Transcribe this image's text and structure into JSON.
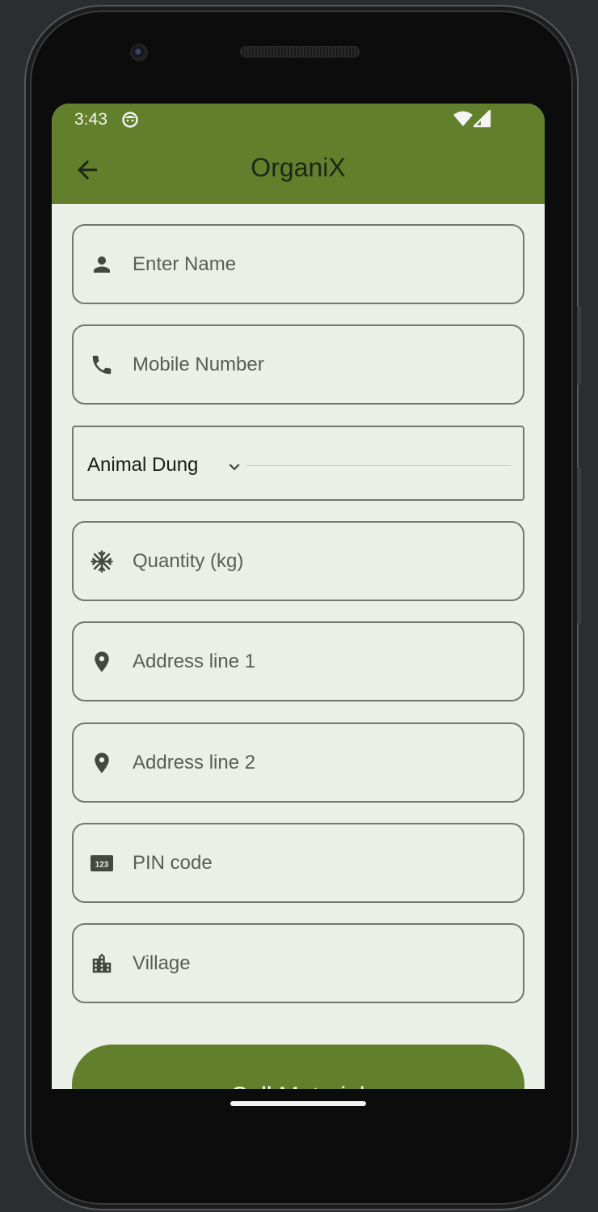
{
  "status_bar": {
    "time": "3:43"
  },
  "app_bar": {
    "title": "OrganiX"
  },
  "form": {
    "name_placeholder": "Enter Name",
    "mobile_placeholder": "Mobile Number",
    "material_selected": "Animal Dung",
    "quantity_placeholder": "Quantity (kg)",
    "address1_placeholder": "Address line 1",
    "address2_placeholder": "Address line 2",
    "pin_placeholder": "PIN code",
    "pin_icon_text": "123",
    "village_placeholder": "Village",
    "submit_label": "Sell Material"
  },
  "icons": {
    "back": "arrow-left-icon",
    "name": "person-icon",
    "mobile": "phone-icon",
    "dropdown": "chevron-down-icon",
    "quantity": "snowflake-icon",
    "address": "location-pin-icon",
    "pin": "pin-123-icon",
    "village": "city-icon"
  },
  "colors": {
    "primary": "#62802c",
    "background": "#eaf0e7",
    "outline": "#73776f",
    "on_primary": "#ffffff"
  }
}
